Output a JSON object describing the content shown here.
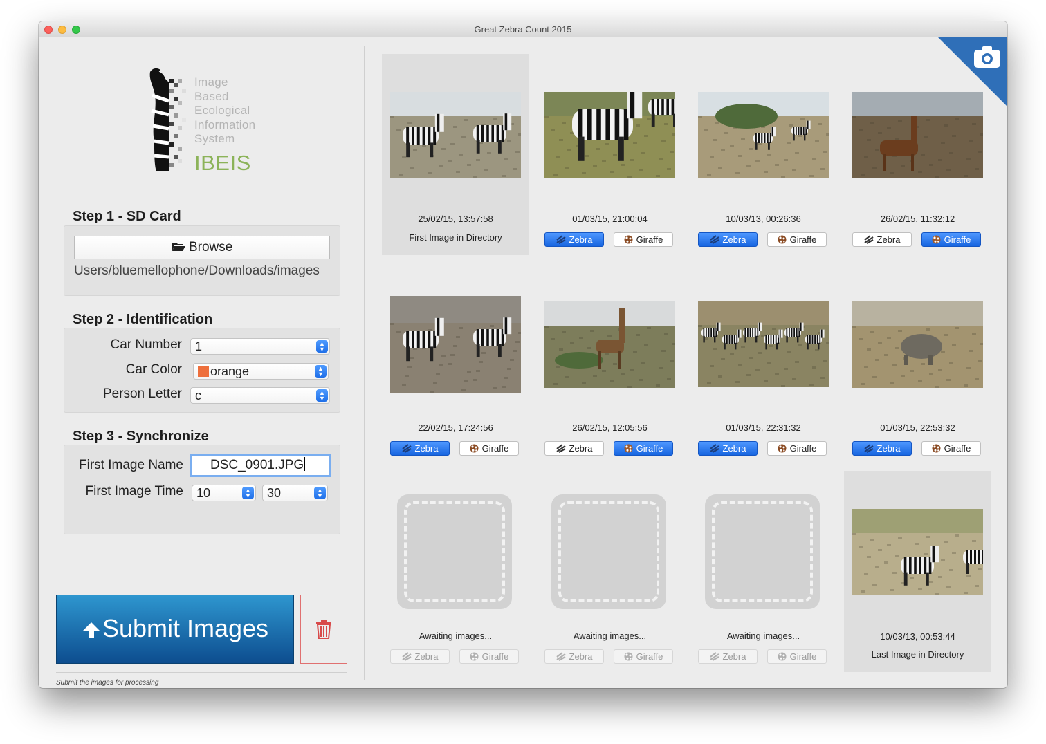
{
  "window": {
    "title": "Great Zebra Count 2015"
  },
  "logo": {
    "lines": [
      "Image",
      "Based",
      "Ecological",
      "Information",
      "System"
    ],
    "name": "IBEIS"
  },
  "step1": {
    "title": "Step 1 - SD Card",
    "browse_label": "Browse",
    "path": "Users/bluemellophone/Downloads/images"
  },
  "step2": {
    "title": "Step 2 - Identification",
    "car_number_label": "Car Number",
    "car_number_value": "1",
    "car_color_label": "Car Color",
    "car_color_value": "orange",
    "car_color_swatch": "#ee6f3c",
    "person_letter_label": "Person Letter",
    "person_letter_value": "c"
  },
  "step3": {
    "title": "Step 3 - Synchronize",
    "first_image_name_label": "First Image Name",
    "first_image_name_value": "DSC_0901.JPG",
    "first_image_time_label": "First Image Time",
    "hour_value": "10",
    "minute_value": "30"
  },
  "submit": {
    "label": "Submit Images",
    "note": "Submit the images for processing"
  },
  "labels": {
    "zebra": "Zebra",
    "giraffe": "Giraffe"
  },
  "images": [
    {
      "timestamp": "25/02/15, 13:57:58",
      "caption": "First Image in Directory",
      "selected": "none"
    },
    {
      "timestamp": "01/03/15, 21:00:04",
      "selected": "zebra"
    },
    {
      "timestamp": "10/03/13, 00:26:36",
      "selected": "zebra"
    },
    {
      "timestamp": "26/02/15, 11:32:12",
      "selected": "giraffe"
    },
    {
      "timestamp": "22/02/15, 17:24:56",
      "selected": "zebra"
    },
    {
      "timestamp": "26/02/15, 12:05:56",
      "selected": "giraffe"
    },
    {
      "timestamp": "01/03/15, 22:31:32",
      "selected": "zebra"
    },
    {
      "timestamp": "01/03/15, 22:53:32",
      "selected": "zebra"
    },
    {
      "caption": "Awaiting images...",
      "selected": "disabled"
    },
    {
      "caption": "Awaiting images...",
      "selected": "disabled"
    },
    {
      "caption": "Awaiting images...",
      "selected": "disabled"
    },
    {
      "timestamp": "10/03/13, 00:53:44",
      "caption": "Last Image in Directory",
      "selected": "none"
    }
  ],
  "colors": {
    "accent": "#1f6fe8",
    "submit": "#1a6aa8",
    "trash": "#d84a4a",
    "logo_green": "#8cb359"
  },
  "icons": [
    "folder-icon",
    "upload-icon",
    "trash-icon",
    "camera-icon",
    "zebra-icon",
    "giraffe-icon"
  ]
}
